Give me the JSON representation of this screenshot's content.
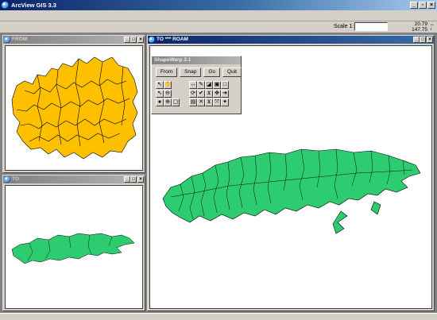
{
  "app": {
    "title": "ArcView GIS 3.3"
  },
  "window_controls": {
    "minimize": "_",
    "restore": "▫",
    "close": "×"
  },
  "toolbar": {
    "scale_label": "Scale 1:",
    "scale_value": "",
    "coord_x": "20.79",
    "coord_y": "147.75"
  },
  "windows": {
    "from": {
      "title": "FROM"
    },
    "to": {
      "title": "TO"
    },
    "roam": {
      "title": "TO *** ROAM"
    }
  },
  "shapewarp": {
    "title": "ShapeWarp 2.1",
    "buttons": [
      "From",
      "Snap",
      "Go",
      "Quit"
    ],
    "tool_icons": [
      "pointer-icon",
      "hand-pan-icon",
      "link-add-icon",
      "link-edit-icon",
      "link-view-icon",
      "select-box-icon",
      "arrow-select-icon",
      "zoom-out-icon",
      "refresh-icon",
      "check-icon",
      "fix-point-icon",
      "fit-extent-icon",
      "next-icon",
      "identify-icon",
      "zoom-in-icon",
      "zoom-box-icon",
      "table-icon",
      "delete-link-icon",
      "save-icon",
      "stretch-icon",
      "warp-icon"
    ]
  },
  "colors": {
    "from_layer": "#ffc000",
    "to_layer": "#2ecc71",
    "outline": "#000000"
  }
}
